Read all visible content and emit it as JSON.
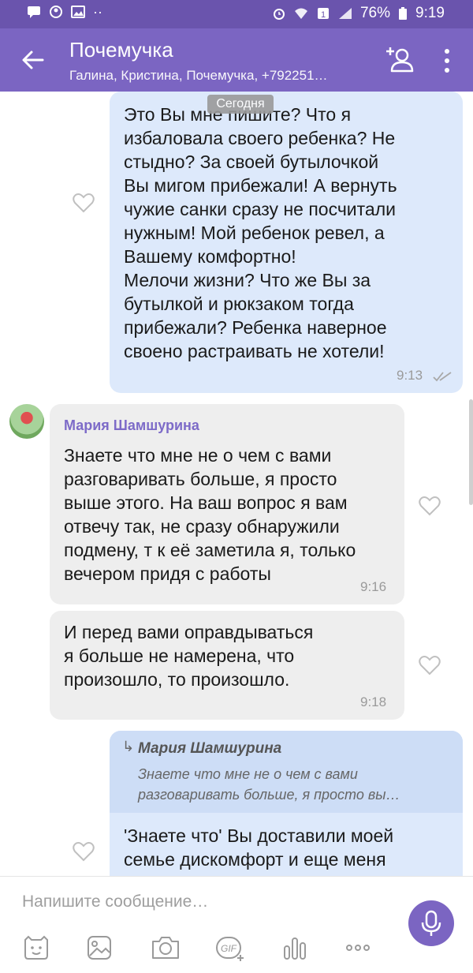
{
  "status_bar": {
    "battery": "76%",
    "time": "9:19"
  },
  "header": {
    "title": "Почемучка",
    "subtitle": "Галина, Кристина, Почемучка, +792251…"
  },
  "chat": {
    "date_chip": "Сегодня",
    "messages": [
      {
        "direction": "outgoing",
        "lines": [
          "Это Вы мне пишите? Что я",
          "избаловала своего ребенка? Не",
          "стыдно? За своей бутылочкой",
          "Вы мигом прибежали! А вернуть",
          "чужие санки сразу не посчитали",
          "нужным! Мой ребенок ревел, а",
          "Вашему комфортно!",
          "Мелочи жизни? Что же Вы за",
          "бутылкой и рюкзаком тогда",
          "прибежали? Ребенка наверное",
          "своено растраивать не хотели!"
        ],
        "time": "9:13"
      },
      {
        "direction": "incoming",
        "sender": "Мария Шамшурина",
        "lines": [
          "Знаете что мне не о чем с вами",
          "разговаривать больше, я просто",
          "выше этого. На ваш вопрос я вам",
          "отвечу так, не сразу обнаружили",
          "подмену, т к её заметила я, только",
          "вечером придя с работы"
        ],
        "time": "9:16"
      },
      {
        "direction": "incoming",
        "lines": [
          "И перед вами оправдываться",
          "я больше не намерена, что",
          "произошло, то произошло."
        ],
        "time": "9:18"
      },
      {
        "direction": "outgoing",
        "reply_to": {
          "sender": "Мария Шамшурина",
          "lines": [
            "Знаете что мне не о чем с вами",
            "разговаривать больше, я просто вы…"
          ]
        },
        "lines": [
          "'Знаете что' Вы доставили моей",
          "семье дискомфорт и еще меня"
        ]
      }
    ]
  },
  "composer": {
    "placeholder": "Напишите сообщение…",
    "toolbar_icons": [
      "sticker-icon",
      "gallery-icon",
      "camera-icon",
      "gif-icon",
      "poll-icon",
      "more-icon"
    ]
  },
  "colors": {
    "header": "#7b65c2",
    "status_bar": "#6a54ad",
    "outgoing_bubble": "#dde9fb",
    "incoming_bubble": "#eeeeee",
    "accent": "#7d6bc8"
  }
}
